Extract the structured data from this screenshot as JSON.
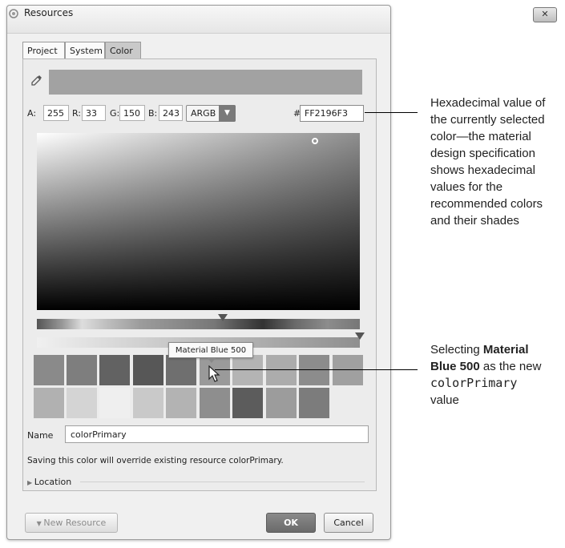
{
  "window": {
    "title": "Resources",
    "close_icon": "close-icon"
  },
  "tabs": [
    {
      "label": "Project",
      "active": false
    },
    {
      "label": "System",
      "active": false
    },
    {
      "label": "Color",
      "active": true
    }
  ],
  "color": {
    "preview_color": "#a2a2a2",
    "channels": {
      "a_label": "A:",
      "a": "255",
      "r_label": "R:",
      "r": "33",
      "g_label": "G:",
      "g": "150",
      "b_label": "B:",
      "b": "243"
    },
    "mode": "ARGB",
    "hex_prefix": "#",
    "hex": "FF2196F3"
  },
  "palette": {
    "tooltip": "Material Blue 500",
    "row1": [
      "#8a8a8a",
      "#7e7e7e",
      "#626262",
      "#575757",
      "#6f6f6f",
      "#9a9a9a",
      "#b4b4b4",
      "#acacac",
      "#8c8c8c",
      "#a0a0a0"
    ],
    "row2": [
      "#b1b1b1",
      "#d4d4d4",
      "#efefef",
      "#c9c9c9",
      "#b3b3b3",
      "#8e8e8e",
      "#5c5c5c",
      "#9c9c9c",
      "#7c7c7c",
      ""
    ]
  },
  "form": {
    "name_label": "Name",
    "name_value": "colorPrimary",
    "warning": "Saving this color will override existing resource colorPrimary.",
    "location_label": "Location"
  },
  "buttons": {
    "new_resource": "New Resource",
    "ok": "OK",
    "cancel": "Cancel"
  },
  "annotations": {
    "hex_note": [
      "Hexadecimal value of",
      "the currently selected",
      "color—the material",
      "design specification",
      "shows hexadecimal",
      "values for the",
      "recommended colors",
      "and their shades"
    ],
    "swatch_note": {
      "line1": "Selecting ",
      "bold1": "Material",
      "bold2": "Blue 500",
      "line2_rest": " as the new",
      "code": "colorPrimary",
      "line4": "value"
    }
  }
}
